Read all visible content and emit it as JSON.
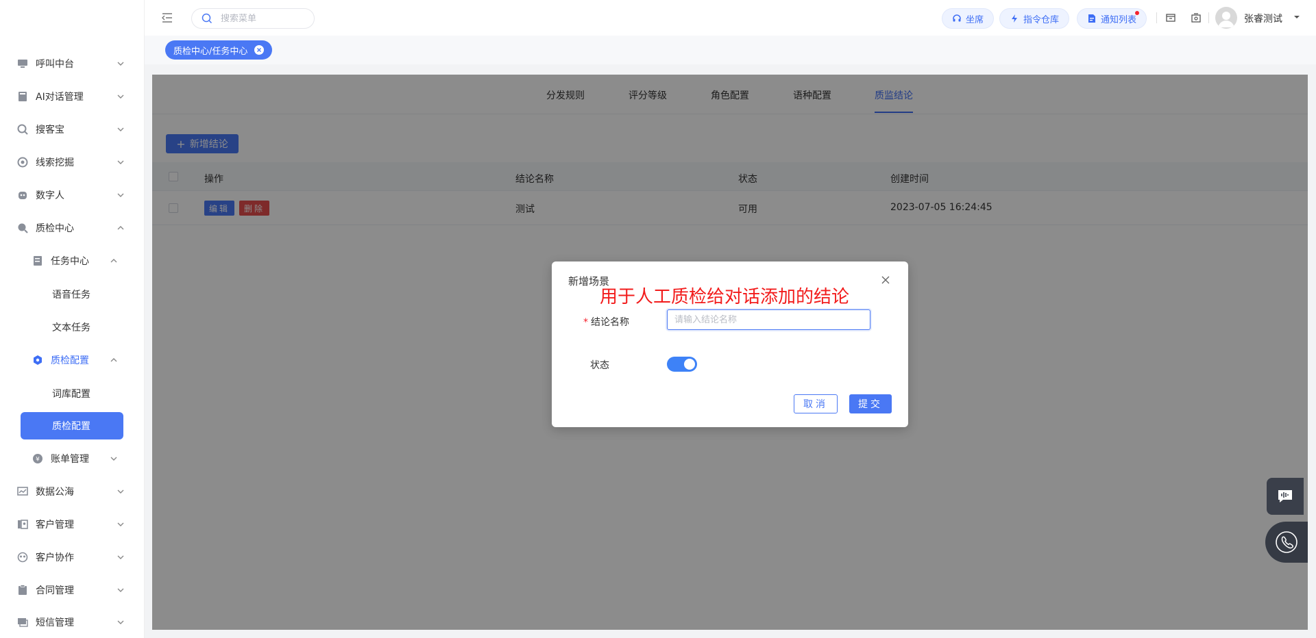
{
  "sidebar": {
    "items": [
      {
        "label": "呼叫中台",
        "icon": "monitor-icon"
      },
      {
        "label": "AI对话管理",
        "icon": "book-icon"
      },
      {
        "label": "搜客宝",
        "icon": "search-circle-icon"
      },
      {
        "label": "线索挖掘",
        "icon": "target-icon"
      },
      {
        "label": "数字人",
        "icon": "robot-icon"
      },
      {
        "label": "质检中心",
        "icon": "inspect-icon"
      },
      {
        "label": "任务中心",
        "icon": "task-icon"
      },
      {
        "label": "语音任务"
      },
      {
        "label": "文本任务"
      },
      {
        "label": "质检配置",
        "icon": "config-hex-icon"
      },
      {
        "label": "词库配置"
      },
      {
        "label": "质检配置"
      },
      {
        "label": "账单管理",
        "icon": "bill-icon"
      },
      {
        "label": "数据公海",
        "icon": "chart-icon"
      },
      {
        "label": "客户管理",
        "icon": "customer-icon"
      },
      {
        "label": "客户协作",
        "icon": "collab-icon"
      },
      {
        "label": "合同管理",
        "icon": "contract-icon"
      },
      {
        "label": "短信管理",
        "icon": "sms-icon"
      }
    ]
  },
  "header": {
    "search_placeholder": "搜索菜单",
    "pills": [
      "坐席",
      "指令仓库",
      "通知列表"
    ],
    "username": "张睿测试"
  },
  "tagbar": {
    "tag": "质检中心/任务中心"
  },
  "tabs": [
    "分发规则",
    "评分等级",
    "角色配置",
    "语种配置",
    "质监结论"
  ],
  "toolbar": {
    "add_label": "新增结论"
  },
  "table": {
    "headers": [
      "操作",
      "结论名称",
      "状态",
      "创建时间"
    ],
    "rows": [
      {
        "edit": "编辑",
        "delete": "删除",
        "name": "测试",
        "status": "可用",
        "created": "2023-07-05 16:24:45"
      }
    ]
  },
  "dialog": {
    "title": "新增场景",
    "annotation": "用于人工质检给对话添加的结论",
    "field_label": "结论名称",
    "field_placeholder": "请输入结论名称",
    "status_label": "状态",
    "status_on": true,
    "cancel": "取消",
    "submit": "提交"
  },
  "colors": {
    "primary": "#4a78f4",
    "danger": "#e54d4d",
    "annotation": "#f21c1c"
  }
}
